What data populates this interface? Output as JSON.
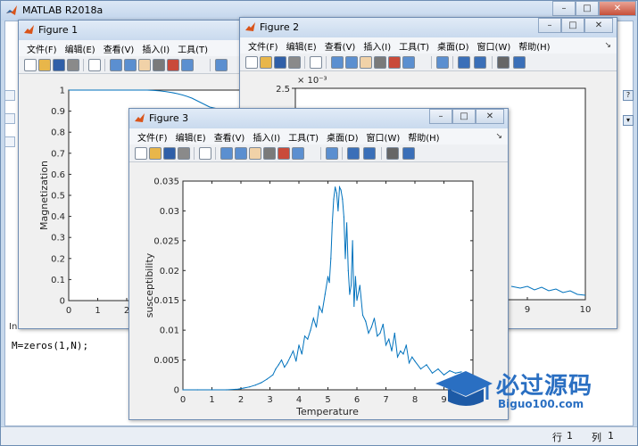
{
  "main_window": {
    "title": "MATLAB R2018a",
    "command_line": "M=zeros(1,N);",
    "partial_label": "In",
    "status": {
      "row_label": "行",
      "row_value": "1",
      "col_label": "列",
      "col_value": "1"
    }
  },
  "figure_menu": [
    "文件(F)",
    "编辑(E)",
    "查看(V)",
    "插入(I)",
    "工具(T)",
    "桌面(D)",
    "窗口(W)",
    "帮助(H)"
  ],
  "figure1": {
    "title": "Figure 1",
    "ylabel": "Magnetization",
    "yticks": [
      "0",
      "0.1",
      "0.2",
      "0.3",
      "0.4",
      "0.5",
      "0.6",
      "0.7",
      "0.8",
      "0.9",
      "1"
    ],
    "xticks": [
      "0",
      "1",
      "2"
    ]
  },
  "figure2": {
    "title": "Figure 2",
    "ytick_top": "2.5",
    "exponent": "× 10⁻³",
    "xticks": [
      "8",
      "9",
      "10"
    ]
  },
  "figure3": {
    "title": "Figure 3",
    "chart_data": {
      "type": "line",
      "xlabel": "Temperature",
      "ylabel": "susceptibility",
      "xlim": [
        0,
        10
      ],
      "ylim": [
        0,
        0.035
      ],
      "xticks": [
        "0",
        "1",
        "2",
        "3",
        "4",
        "5",
        "6",
        "7",
        "8",
        "9"
      ],
      "yticks": [
        "0",
        "0.005",
        "0.01",
        "0.015",
        "0.02",
        "0.025",
        "0.03",
        "0.035"
      ],
      "color": "#0072bd",
      "x": [
        0,
        0.5,
        1,
        1.5,
        1.9,
        2.1,
        2.3,
        2.5,
        2.7,
        2.9,
        3.1,
        3.2,
        3.3,
        3.4,
        3.5,
        3.6,
        3.7,
        3.8,
        3.9,
        4.0,
        4.1,
        4.2,
        4.3,
        4.4,
        4.5,
        4.6,
        4.7,
        4.8,
        4.9,
        5.0,
        5.05,
        5.1,
        5.15,
        5.2,
        5.25,
        5.3,
        5.35,
        5.4,
        5.45,
        5.5,
        5.55,
        5.6,
        5.65,
        5.7,
        5.75,
        5.8,
        5.85,
        5.9,
        5.95,
        6.0,
        6.1,
        6.2,
        6.3,
        6.4,
        6.5,
        6.6,
        6.7,
        6.8,
        6.9,
        7.0,
        7.1,
        7.2,
        7.3,
        7.4,
        7.5,
        7.6,
        7.7,
        7.8,
        7.9,
        8.0,
        8.2,
        8.4,
        8.6,
        8.8,
        9.0,
        9.2,
        9.4,
        9.6
      ],
      "y": [
        0,
        0,
        0,
        0,
        0.0001,
        0.0003,
        0.0005,
        0.0008,
        0.0012,
        0.0018,
        0.0025,
        0.0035,
        0.0042,
        0.005,
        0.0038,
        0.0045,
        0.0055,
        0.0065,
        0.0048,
        0.0075,
        0.006,
        0.009,
        0.0085,
        0.01,
        0.012,
        0.0105,
        0.014,
        0.013,
        0.016,
        0.019,
        0.018,
        0.022,
        0.028,
        0.032,
        0.034,
        0.033,
        0.03,
        0.034,
        0.0335,
        0.032,
        0.029,
        0.022,
        0.028,
        0.02,
        0.016,
        0.0175,
        0.025,
        0.014,
        0.019,
        0.015,
        0.0175,
        0.0125,
        0.0115,
        0.0095,
        0.0105,
        0.012,
        0.009,
        0.0095,
        0.011,
        0.0075,
        0.0085,
        0.0065,
        0.0095,
        0.0055,
        0.0065,
        0.006,
        0.0075,
        0.0045,
        0.0055,
        0.0048,
        0.0035,
        0.0042,
        0.0028,
        0.0035,
        0.0025,
        0.0032,
        0.0028,
        0.003
      ]
    }
  },
  "watermark": {
    "text": "必过源码",
    "site": "Biguo100.com"
  }
}
